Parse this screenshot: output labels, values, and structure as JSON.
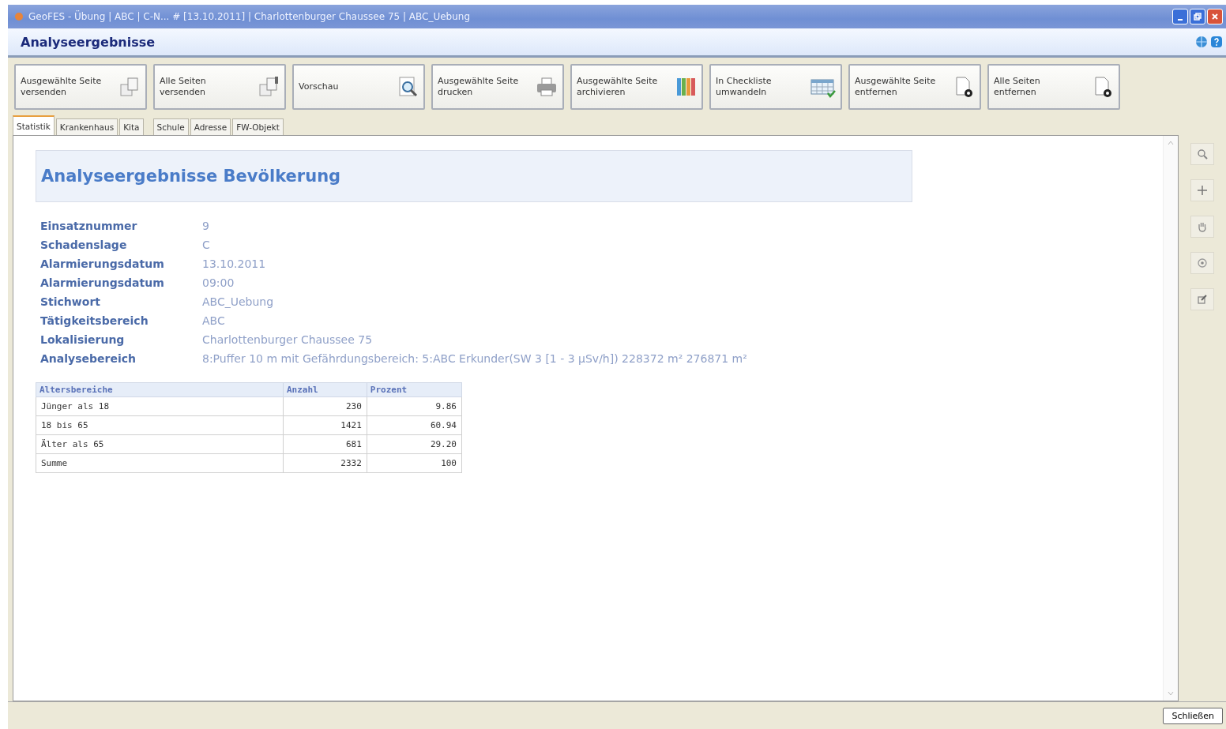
{
  "window": {
    "title": "GeoFES - Übung | ABC | C-N... # [13.10.2011] | Charlottenburger Chaussee 75 | ABC_Uebung"
  },
  "header": {
    "title": "Analyseergebnisse"
  },
  "toolbar": [
    {
      "label": "Ausgewählte Seite versenden",
      "kind": "send"
    },
    {
      "label": "Alle Seiten versenden",
      "kind": "sendall"
    },
    {
      "label": "Vorschau",
      "kind": "preview"
    },
    {
      "label": "Ausgewählte Seite drucken",
      "kind": "print"
    },
    {
      "label": "Ausgewählte Seite archivieren",
      "kind": "archive"
    },
    {
      "label": "In Checkliste umwandeln",
      "kind": "checklist"
    },
    {
      "label": "Ausgewählte Seite entfernen",
      "kind": "remove"
    },
    {
      "label": "Alle Seiten entfernen",
      "kind": "removeall"
    }
  ],
  "tabs": [
    {
      "label": "Statistik",
      "selected": true
    },
    {
      "label": "Krankenhaus",
      "selected": false
    },
    {
      "label": "Kita",
      "selected": false
    },
    {
      "label": "Schule",
      "selected": false
    },
    {
      "label": "Adresse",
      "selected": false
    },
    {
      "label": "FW-Objekt",
      "selected": false
    }
  ],
  "report": {
    "title": "Analyseergebnisse Bevölkerung",
    "fields": [
      {
        "label": "Einsatznummer",
        "value": "9"
      },
      {
        "label": "Schadenslage",
        "value": "C"
      },
      {
        "label": "Alarmierungsdatum",
        "value": "13.10.2011"
      },
      {
        "label": "Alarmierungsdatum",
        "value": "09:00"
      },
      {
        "label": "Stichwort",
        "value": "ABC_Uebung"
      },
      {
        "label": "Tätigkeitsbereich",
        "value": "ABC"
      },
      {
        "label": "Lokalisierung",
        "value": "Charlottenburger Chaussee 75"
      },
      {
        "label": "Analysebereich",
        "value": "8:Puffer 10 m mit Gefährdungsbereich: 5:ABC Erkunder(SW 3 [1 - 3 µSv/h]) 228372 m² 276871 m²"
      }
    ],
    "table": {
      "columns": [
        "Altersbereiche",
        "Anzahl",
        "Prozent"
      ],
      "rows": [
        [
          "Jünger als 18",
          "230",
          "9.86"
        ],
        [
          "18 bis 65",
          "1421",
          "60.94"
        ],
        [
          "Älter als 65",
          "681",
          "29.20"
        ],
        [
          "Summe",
          "2332",
          "100"
        ]
      ]
    }
  },
  "footer": {
    "close_button": "Schließen"
  }
}
